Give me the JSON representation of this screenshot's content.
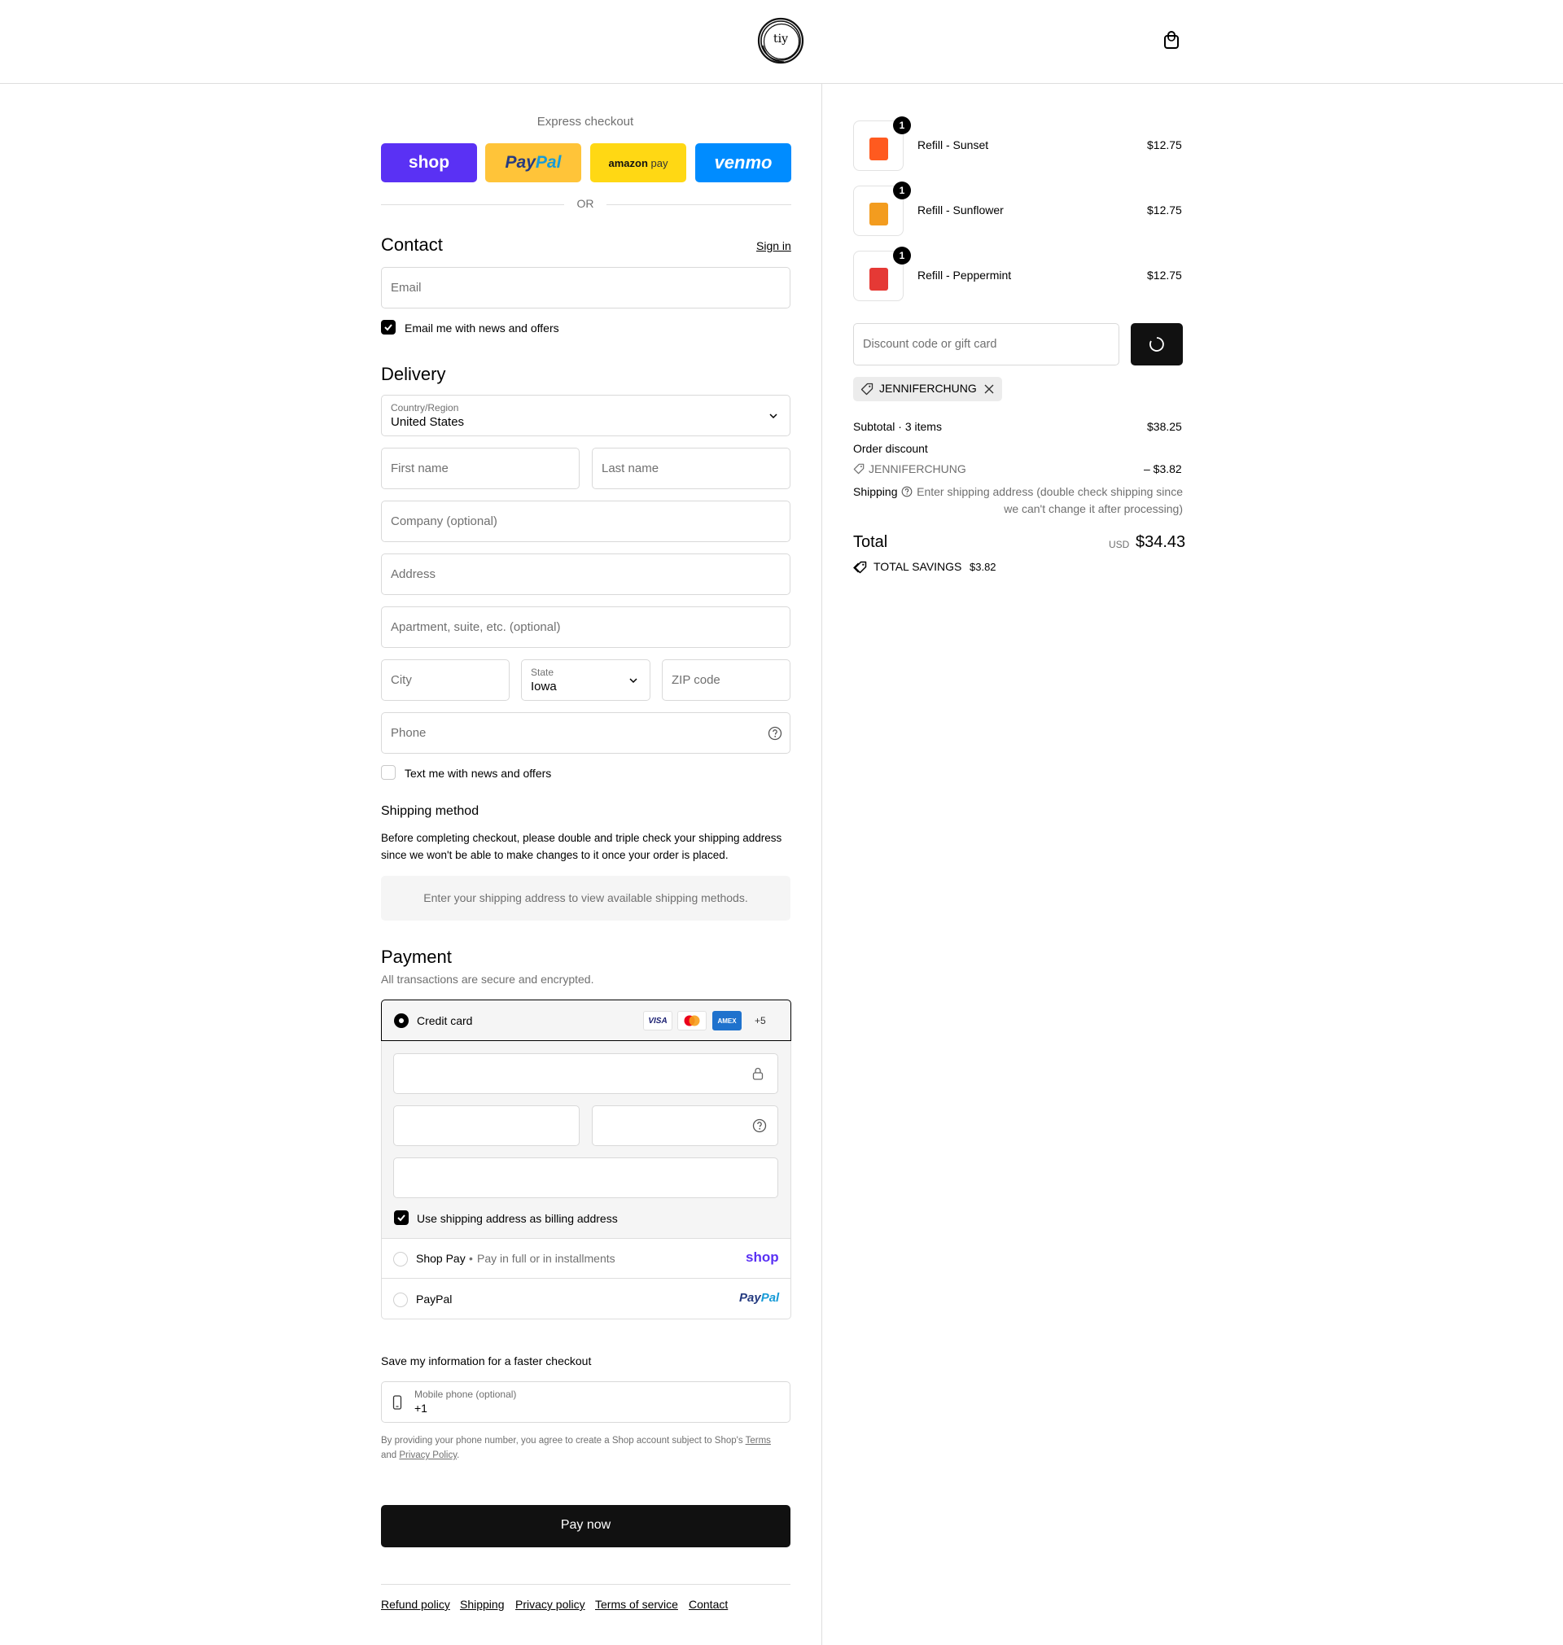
{
  "header": {
    "logo_text": "tiy",
    "cart_icon": "shopping-bag-icon"
  },
  "express": {
    "title": "Express checkout",
    "shop_label": "shop",
    "paypal_label_a": "Pay",
    "paypal_label_b": "Pal",
    "amazon_label_a": "amazon",
    "amazon_label_b": "pay",
    "venmo_label": "venmo",
    "or_label": "OR",
    "colors": {
      "shop": "#5a31f4",
      "paypal": "#ffc439",
      "amazon": "#ffd814",
      "venmo": "#008cff"
    }
  },
  "contact": {
    "title": "Contact",
    "sign_in": "Sign in",
    "email_placeholder": "Email",
    "email_news_label": "Email me with news and offers"
  },
  "delivery": {
    "title": "Delivery",
    "country_label": "Country/Region",
    "country_value": "United States",
    "first_name_placeholder": "First name",
    "last_name_placeholder": "Last name",
    "company_placeholder": "Company (optional)",
    "address_placeholder": "Address",
    "apartment_placeholder": "Apartment, suite, etc. (optional)",
    "city_placeholder": "City",
    "state_label": "State",
    "state_value": "Iowa",
    "zip_placeholder": "ZIP code",
    "phone_placeholder": "Phone",
    "text_news_label": "Text me with news and offers"
  },
  "shipping_method": {
    "title": "Shipping method",
    "note_line1": "Before completing checkout, please double and triple check your shipping address",
    "note_line2": "since we won't be able to make changes to it once your order is placed.",
    "placeholder": "Enter your shipping address to view available shipping methods."
  },
  "payment": {
    "title": "Payment",
    "subtitle": "All transactions are secure and encrypted.",
    "credit_card_label": "Credit card",
    "visa_label": "VISA",
    "amex_label": "AMEX",
    "more_cards": "+5",
    "billing_label": "Use shipping address as billing address",
    "shop_pay_label": "Shop Pay",
    "shop_pay_sub": "Pay in full or in installments",
    "shop_pay_logo": "shop",
    "paypal_label": "PayPal",
    "paypal_logo_a": "Pay",
    "paypal_logo_b": "Pal"
  },
  "save_info": {
    "title": "Save my information for a faster checkout",
    "mobile_label": "Mobile phone (optional)",
    "mobile_value": "+1",
    "disclaimer_a": "By providing your phone number, you agree to create a Shop account subject to Shop's",
    "terms_link": "Terms",
    "disclaimer_b": "and",
    "privacy_link": "Privacy Policy",
    "disclaimer_c": "."
  },
  "pay_now": "Pay now",
  "footer_links": [
    "Refund policy",
    "Shipping",
    "Privacy policy",
    "Terms of service",
    "Contact"
  ],
  "order": {
    "items": [
      {
        "name": "Refill - Sunset",
        "price": "$12.75",
        "qty": "1",
        "color": "#ff5a1f"
      },
      {
        "name": "Refill - Sunflower",
        "price": "$12.75",
        "qty": "1",
        "color": "#f39c1f"
      },
      {
        "name": "Refill - Peppermint",
        "price": "$12.75",
        "qty": "1",
        "color": "#e53935"
      }
    ],
    "discount_placeholder": "Discount code or gift card",
    "applied_code": "JENNIFERCHUNG",
    "subtotal_label": "Subtotal · 3 items",
    "subtotal_value": "$38.25",
    "order_discount_label": "Order discount",
    "discount_code": "JENNIFERCHUNG",
    "discount_value": "– $3.82",
    "shipping_label": "Shipping",
    "shipping_note_line1": "Enter shipping address (double check shipping since",
    "shipping_note_line2": "we can't change it after processing)",
    "total_label": "Total",
    "currency": "USD",
    "total_value": "$34.43",
    "savings_label": "TOTAL SAVINGS",
    "savings_value": "$3.82"
  }
}
